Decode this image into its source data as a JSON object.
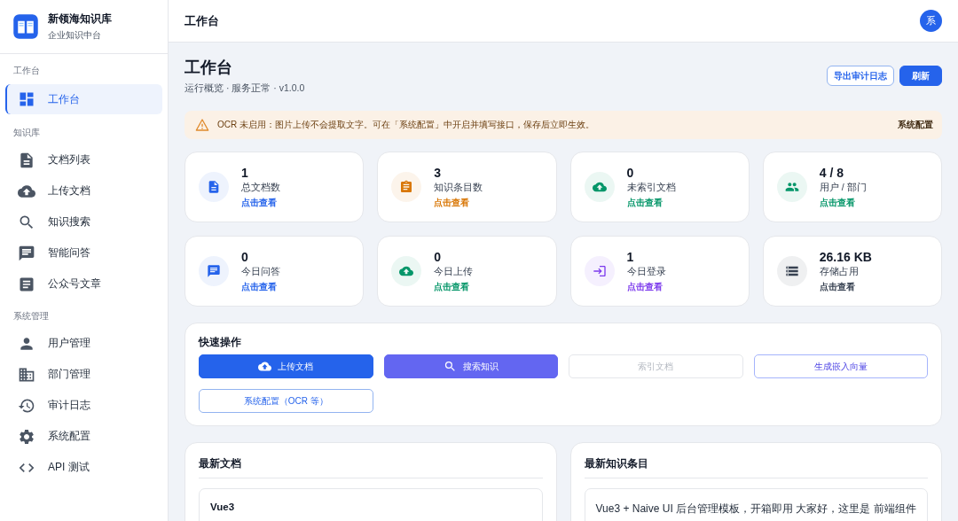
{
  "brand": {
    "name": "新领海知识库",
    "subtitle": "企业知识中台"
  },
  "sidebar": {
    "groups": [
      {
        "label": "工作台",
        "items": [
          {
            "label": "工作台",
            "selected": true
          }
        ]
      },
      {
        "label": "知识库",
        "items": [
          {
            "label": "文档列表",
            "selected": false
          },
          {
            "label": "上传文档",
            "selected": false
          },
          {
            "label": "知识搜索",
            "selected": false
          },
          {
            "label": "智能问答",
            "selected": false
          },
          {
            "label": "公众号文章",
            "selected": false
          }
        ]
      },
      {
        "label": "系统管理",
        "items": [
          {
            "label": "用户管理",
            "selected": false
          },
          {
            "label": "部门管理",
            "selected": false
          },
          {
            "label": "审计日志",
            "selected": false
          },
          {
            "label": "系统配置",
            "selected": false
          },
          {
            "label": "API 测试",
            "selected": false
          }
        ]
      }
    ]
  },
  "topbar": {
    "title": "工作台",
    "avatar": "系"
  },
  "page": {
    "title": "工作台",
    "subtitle": "运行概览 · 服务正常 · v1.0.0",
    "buttons": [
      {
        "label": "导出审计日志",
        "kind": "outline"
      },
      {
        "label": "刷新",
        "kind": "primary"
      }
    ]
  },
  "alert": {
    "text": "OCR 未启用：图片上传不会提取文字。可在「系统配置」中开启并填写接口，保存后立即生效。",
    "action": "系统配置"
  },
  "stats": [
    {
      "value": "1",
      "label": "总文档数",
      "link": "点击查看",
      "color": "#2563eb"
    },
    {
      "value": "3",
      "label": "知识条目数",
      "link": "点击查看",
      "color": "#d97706"
    },
    {
      "value": "0",
      "label": "未索引文档",
      "link": "点击查看",
      "color": "#059669"
    },
    {
      "value": "4 / 8",
      "label": "用户 / 部门",
      "link": "点击查看",
      "color": "#059669"
    },
    {
      "value": "0",
      "label": "今日问答",
      "link": "点击查看",
      "color": "#2563eb"
    },
    {
      "value": "0",
      "label": "今日上传",
      "link": "点击查看",
      "color": "#059669"
    },
    {
      "value": "1",
      "label": "今日登录",
      "link": "点击查看",
      "color": "#7c3aed"
    },
    {
      "value": "26.16 KB",
      "label": "存储占用",
      "link": "点击查看",
      "color": "#374151"
    }
  ],
  "quick_actions": {
    "title": "快速操作",
    "buttons": [
      {
        "label": "上传文档",
        "kind": "primary",
        "disabled": false
      },
      {
        "label": "搜索知识",
        "kind": "accent",
        "disabled": false
      },
      {
        "label": "索引文档",
        "kind": "outline",
        "disabled": true
      },
      {
        "label": "生成嵌入向量",
        "kind": "outline-accent",
        "disabled": false
      },
      {
        "label": "系统配置（OCR 等）",
        "kind": "outline",
        "disabled": false
      }
    ]
  },
  "recent_documents": {
    "title": "最新文档",
    "items": [
      {
        "title": "Vue3"
      }
    ]
  },
  "recent_knowledge": {
    "title": "最新知识条目",
    "items": [
      {
        "text": "Vue3 + Naive UI 后台管理模板，开箱即用 大家好，这里是 前端组件"
      }
    ]
  }
}
